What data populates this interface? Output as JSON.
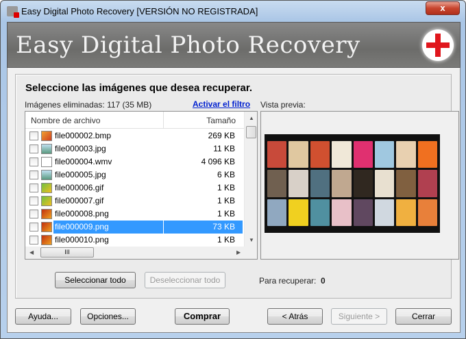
{
  "window": {
    "title": "Easy Digital Photo Recovery [VERSIÓN NO REGISTRADA]",
    "close_label": "x"
  },
  "banner": {
    "title": "Easy Digital Photo Recovery"
  },
  "main": {
    "heading": "Seleccione las imágenes que desea recuperar.",
    "deleted_count": "Imágenes eliminadas: 117 (35 MB)",
    "filter_link": "Activar el filtro",
    "preview_label": "Vista previa:",
    "columns": {
      "name": "Nombre de archivo",
      "size": "Tamaño"
    },
    "files": [
      {
        "name": "file000002.bmp",
        "size": "269 KB",
        "icon": "bmp",
        "selected": false
      },
      {
        "name": "file000003.jpg",
        "size": "11 KB",
        "icon": "jpg",
        "selected": false
      },
      {
        "name": "file000004.wmv",
        "size": "4 096 KB",
        "icon": "wmv",
        "selected": false
      },
      {
        "name": "file000005.jpg",
        "size": "6 KB",
        "icon": "jpg",
        "selected": false
      },
      {
        "name": "file000006.gif",
        "size": "1 KB",
        "icon": "gif",
        "selected": false
      },
      {
        "name": "file000007.gif",
        "size": "1 KB",
        "icon": "gif",
        "selected": false
      },
      {
        "name": "file000008.png",
        "size": "1 KB",
        "icon": "png",
        "selected": false
      },
      {
        "name": "file000009.png",
        "size": "73 KB",
        "icon": "png",
        "selected": true
      },
      {
        "name": "file000010.png",
        "size": "1 KB",
        "icon": "png",
        "selected": false
      }
    ],
    "hscroll_grip": "III",
    "select_all": "Seleccionar todo",
    "deselect_all": "Deseleccionar todo",
    "to_recover_label": "Para recuperar:",
    "to_recover_count": "0"
  },
  "footer": {
    "help": "Ayuda...",
    "options": "Opciones...",
    "buy": "Comprar",
    "back": "< Atrás",
    "next": "Siguiente >",
    "close": "Cerrar"
  },
  "colors": {
    "selection": "#3399ff",
    "link": "#0020d0",
    "plus": "#e0161c"
  }
}
